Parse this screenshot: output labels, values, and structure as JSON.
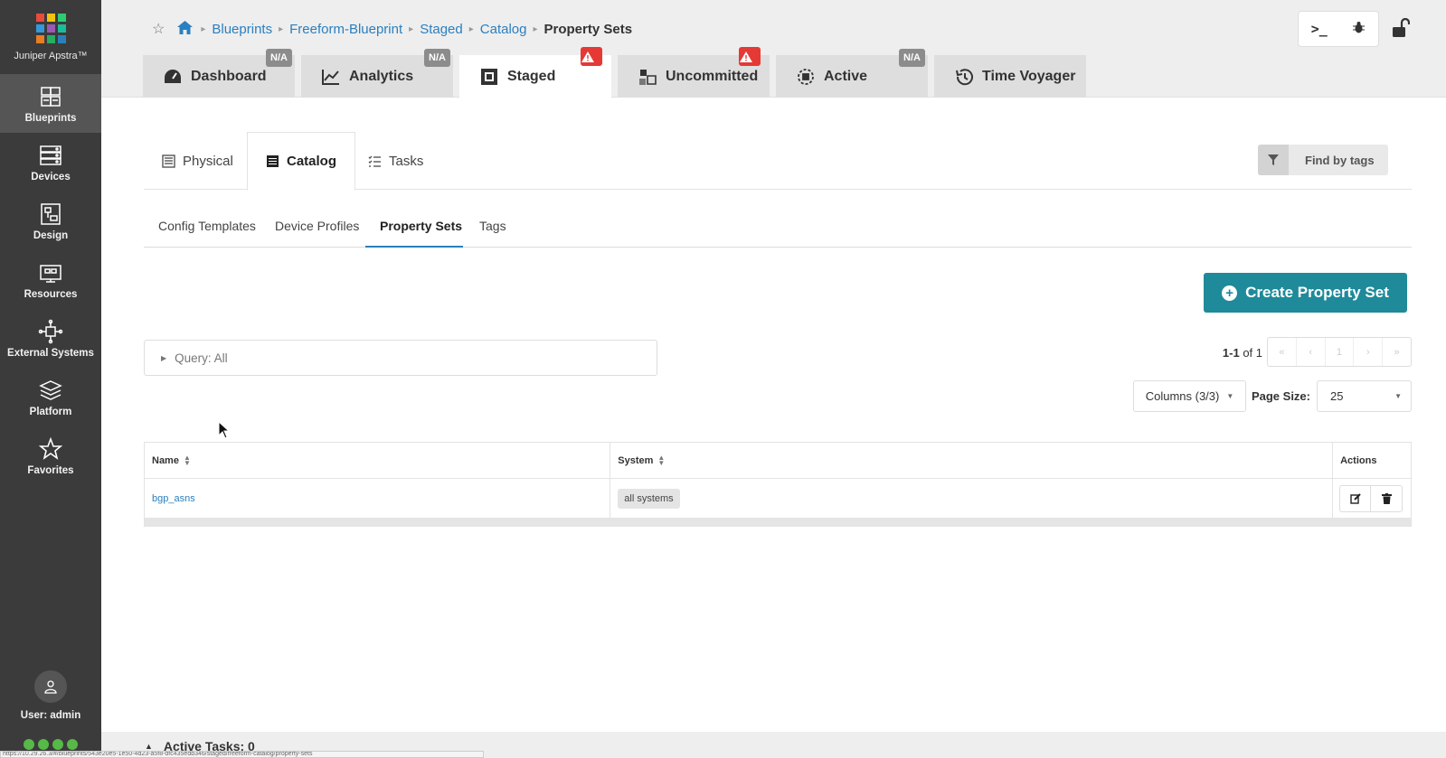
{
  "app": {
    "brand": "Juniper Apstra™",
    "brand_colors": [
      "#e74c3c",
      "#f1c40f",
      "#2ecc71",
      "#3498db",
      "#9b59b6",
      "#1abc9c",
      "#e67e22",
      "#34495e",
      "#95a5a6"
    ]
  },
  "sidebar": {
    "items": [
      {
        "label": "Blueprints",
        "icon": "blueprints-icon",
        "active": true
      },
      {
        "label": "Devices",
        "icon": "devices-icon"
      },
      {
        "label": "Design",
        "icon": "design-icon"
      },
      {
        "label": "Resources",
        "icon": "resources-icon"
      },
      {
        "label": "External Systems",
        "icon": "external-systems-icon"
      },
      {
        "label": "Platform",
        "icon": "platform-icon"
      },
      {
        "label": "Favorites",
        "icon": "star-icon"
      }
    ],
    "user_label": "User: admin"
  },
  "breadcrumb": {
    "items": [
      "Blueprints",
      "Freeform-Blueprint",
      "Staged",
      "Catalog"
    ],
    "current": "Property Sets"
  },
  "toolbar": {
    "cli_label": ">_"
  },
  "main_tabs": [
    {
      "label": "Dashboard",
      "badge": "N/A"
    },
    {
      "label": "Analytics",
      "badge": "N/A"
    },
    {
      "label": "Staged",
      "badge": "warning",
      "active": true
    },
    {
      "label": "Uncommitted",
      "badge": "warning"
    },
    {
      "label": "Active",
      "badge": "N/A"
    },
    {
      "label": "Time Voyager",
      "badge": ""
    }
  ],
  "sub_tabs": [
    {
      "label": "Physical"
    },
    {
      "label": "Catalog",
      "active": true
    },
    {
      "label": "Tasks"
    }
  ],
  "find_tags_label": "Find by tags",
  "catalog_tabs": [
    {
      "label": "Config Templates"
    },
    {
      "label": "Device Profiles"
    },
    {
      "label": "Property Sets",
      "active": true
    },
    {
      "label": "Tags"
    }
  ],
  "create_button_label": "Create Property Set",
  "query_label": "Query: All",
  "pagination": {
    "range": "1-1",
    "of": "of 1",
    "page": "1",
    "first": "«",
    "prev": "‹",
    "next": "›",
    "last": "»"
  },
  "columns_button_label": "Columns (3/3)",
  "page_size_label": "Page Size:",
  "page_size_value": "25",
  "table": {
    "headers": {
      "name": "Name",
      "system": "System",
      "actions": "Actions"
    },
    "rows": [
      {
        "name": "bgp_asns",
        "system": "all systems"
      }
    ]
  },
  "active_tasks_label": "Active Tasks: 0",
  "status_url": "https://10.29.26.3/#/blueprints/543e20e5-1e50-4d23-a5f8-dfc435edb346/staged/freeform-catalog/property-sets",
  "colors": {
    "accent": "#2a7fbf",
    "create_button": "#1f8a99",
    "warning": "#e53935",
    "sidebar": "#3b3b3b",
    "status_dot": "#57b947"
  }
}
